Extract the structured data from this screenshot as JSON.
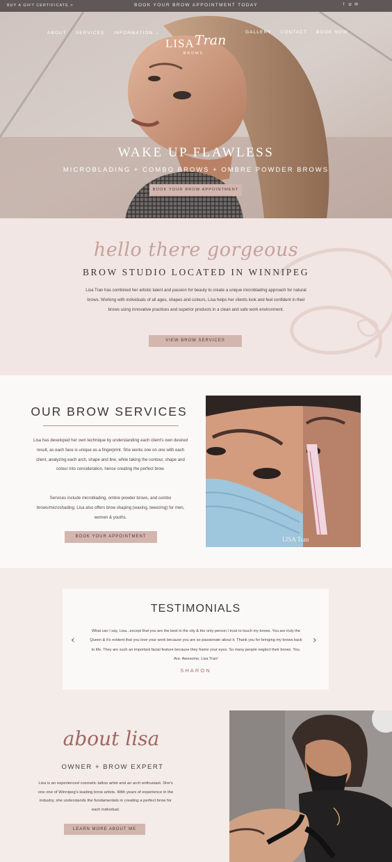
{
  "topbar": {
    "gift_link": "BUY A GIFT CERTIFICATE >",
    "book_banner": "BOOK YOUR BROW APPOINTMENT TODAY",
    "social": [
      "facebook-icon",
      "instagram-icon",
      "email-icon"
    ]
  },
  "nav": {
    "left": [
      "ABOUT",
      "SERVICES",
      "INFORMATION ⌄"
    ],
    "right": [
      "GALLERY",
      "CONTACT",
      "BOOK NOW"
    ]
  },
  "logo": {
    "name": "LISA",
    "script": "Tran",
    "tagline": "BROWS"
  },
  "hero": {
    "title": "WAKE UP FLAWLESS",
    "subtitle": "MICROBLADING + COMBO BROWS + OMBRE POWDER BROWS",
    "cta": "BOOK YOUR BROW APPOINTMENT"
  },
  "intro": {
    "script": "hello there gorgeous",
    "heading": "BROW STUDIO LOCATED IN WINNIPEG",
    "paragraph": "Lisa Tran has combined her artistic talent and passion for beauty to create a unique microblading approach for natural brows. Working with individuals of all ages, shapes and colours, Lisa helps her clients look and feel confident in their brows using innovative practices and superior products in a clean and safe work environment.",
    "cta": "VIEW BROW SERVICES"
  },
  "services": {
    "title": "OUR BROW SERVICES",
    "p1": "Lisa has developed her own technique by understanding each client's own desired result, as each face is unique as a fingerprint. She works one on one with each client, analyzing each arch, shape and line, while taking the contour, shape and colour into consideration, hence creating the perfect brow.",
    "p2": "Services include microblading, ombre powder brows, and combo brows/microshading. Lisa also offers brow shaping (waxing, tweezing) for men, women & youths.",
    "cta": "BOOK YOUR APPOINTMENT",
    "photo_watermark": "LISA Tran"
  },
  "testimonials": {
    "title": "TESTIMONIALS",
    "quote": "What can I say, Lisa...except that you are the best in the city & the only person I trust to touch my brows. You are truly the Queen & it's evident that you love your work because you are so passionate about it. Thank you for bringing my brows back to life. They are such an important facial feature because they frame your eyes. So many people neglect their brows. You. Are. Awesome, Lisa Tran!",
    "author": "SHARON",
    "prev": "‹",
    "next": "›"
  },
  "about": {
    "script": "about lisa",
    "subtitle": "OWNER + BROW EXPERT",
    "paragraph": "Lisa is an experienced cosmetic tattoo artist and an arch enthusiast. She's one one of Winnipeg's leading brow artists. With years of experience in the industry, she understands the fundamentals in creating a perfect brow for each individual.",
    "cta": "LEARN MORE ABOUT ME"
  }
}
